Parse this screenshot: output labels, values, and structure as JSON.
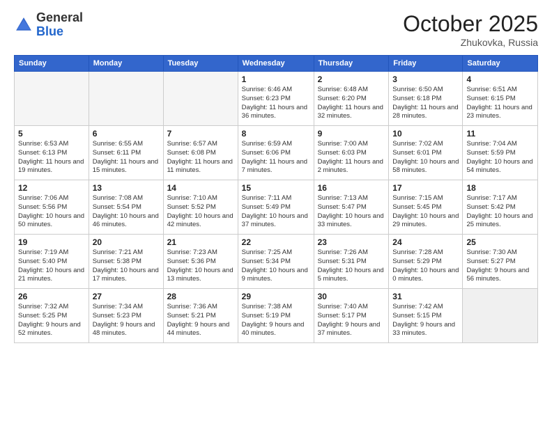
{
  "header": {
    "logo_general": "General",
    "logo_blue": "Blue",
    "month": "October 2025",
    "location": "Zhukovka, Russia"
  },
  "days_of_week": [
    "Sunday",
    "Monday",
    "Tuesday",
    "Wednesday",
    "Thursday",
    "Friday",
    "Saturday"
  ],
  "weeks": [
    [
      {
        "day": "",
        "info": ""
      },
      {
        "day": "",
        "info": ""
      },
      {
        "day": "",
        "info": ""
      },
      {
        "day": "1",
        "info": "Sunrise: 6:46 AM\nSunset: 6:23 PM\nDaylight: 11 hours\nand 36 minutes."
      },
      {
        "day": "2",
        "info": "Sunrise: 6:48 AM\nSunset: 6:20 PM\nDaylight: 11 hours\nand 32 minutes."
      },
      {
        "day": "3",
        "info": "Sunrise: 6:50 AM\nSunset: 6:18 PM\nDaylight: 11 hours\nand 28 minutes."
      },
      {
        "day": "4",
        "info": "Sunrise: 6:51 AM\nSunset: 6:15 PM\nDaylight: 11 hours\nand 23 minutes."
      }
    ],
    [
      {
        "day": "5",
        "info": "Sunrise: 6:53 AM\nSunset: 6:13 PM\nDaylight: 11 hours\nand 19 minutes."
      },
      {
        "day": "6",
        "info": "Sunrise: 6:55 AM\nSunset: 6:11 PM\nDaylight: 11 hours\nand 15 minutes."
      },
      {
        "day": "7",
        "info": "Sunrise: 6:57 AM\nSunset: 6:08 PM\nDaylight: 11 hours\nand 11 minutes."
      },
      {
        "day": "8",
        "info": "Sunrise: 6:59 AM\nSunset: 6:06 PM\nDaylight: 11 hours\nand 7 minutes."
      },
      {
        "day": "9",
        "info": "Sunrise: 7:00 AM\nSunset: 6:03 PM\nDaylight: 11 hours\nand 2 minutes."
      },
      {
        "day": "10",
        "info": "Sunrise: 7:02 AM\nSunset: 6:01 PM\nDaylight: 10 hours\nand 58 minutes."
      },
      {
        "day": "11",
        "info": "Sunrise: 7:04 AM\nSunset: 5:59 PM\nDaylight: 10 hours\nand 54 minutes."
      }
    ],
    [
      {
        "day": "12",
        "info": "Sunrise: 7:06 AM\nSunset: 5:56 PM\nDaylight: 10 hours\nand 50 minutes."
      },
      {
        "day": "13",
        "info": "Sunrise: 7:08 AM\nSunset: 5:54 PM\nDaylight: 10 hours\nand 46 minutes."
      },
      {
        "day": "14",
        "info": "Sunrise: 7:10 AM\nSunset: 5:52 PM\nDaylight: 10 hours\nand 42 minutes."
      },
      {
        "day": "15",
        "info": "Sunrise: 7:11 AM\nSunset: 5:49 PM\nDaylight: 10 hours\nand 37 minutes."
      },
      {
        "day": "16",
        "info": "Sunrise: 7:13 AM\nSunset: 5:47 PM\nDaylight: 10 hours\nand 33 minutes."
      },
      {
        "day": "17",
        "info": "Sunrise: 7:15 AM\nSunset: 5:45 PM\nDaylight: 10 hours\nand 29 minutes."
      },
      {
        "day": "18",
        "info": "Sunrise: 7:17 AM\nSunset: 5:42 PM\nDaylight: 10 hours\nand 25 minutes."
      }
    ],
    [
      {
        "day": "19",
        "info": "Sunrise: 7:19 AM\nSunset: 5:40 PM\nDaylight: 10 hours\nand 21 minutes."
      },
      {
        "day": "20",
        "info": "Sunrise: 7:21 AM\nSunset: 5:38 PM\nDaylight: 10 hours\nand 17 minutes."
      },
      {
        "day": "21",
        "info": "Sunrise: 7:23 AM\nSunset: 5:36 PM\nDaylight: 10 hours\nand 13 minutes."
      },
      {
        "day": "22",
        "info": "Sunrise: 7:25 AM\nSunset: 5:34 PM\nDaylight: 10 hours\nand 9 minutes."
      },
      {
        "day": "23",
        "info": "Sunrise: 7:26 AM\nSunset: 5:31 PM\nDaylight: 10 hours\nand 5 minutes."
      },
      {
        "day": "24",
        "info": "Sunrise: 7:28 AM\nSunset: 5:29 PM\nDaylight: 10 hours\nand 0 minutes."
      },
      {
        "day": "25",
        "info": "Sunrise: 7:30 AM\nSunset: 5:27 PM\nDaylight: 9 hours\nand 56 minutes."
      }
    ],
    [
      {
        "day": "26",
        "info": "Sunrise: 7:32 AM\nSunset: 5:25 PM\nDaylight: 9 hours\nand 52 minutes."
      },
      {
        "day": "27",
        "info": "Sunrise: 7:34 AM\nSunset: 5:23 PM\nDaylight: 9 hours\nand 48 minutes."
      },
      {
        "day": "28",
        "info": "Sunrise: 7:36 AM\nSunset: 5:21 PM\nDaylight: 9 hours\nand 44 minutes."
      },
      {
        "day": "29",
        "info": "Sunrise: 7:38 AM\nSunset: 5:19 PM\nDaylight: 9 hours\nand 40 minutes."
      },
      {
        "day": "30",
        "info": "Sunrise: 7:40 AM\nSunset: 5:17 PM\nDaylight: 9 hours\nand 37 minutes."
      },
      {
        "day": "31",
        "info": "Sunrise: 7:42 AM\nSunset: 5:15 PM\nDaylight: 9 hours\nand 33 minutes."
      },
      {
        "day": "",
        "info": ""
      }
    ]
  ]
}
